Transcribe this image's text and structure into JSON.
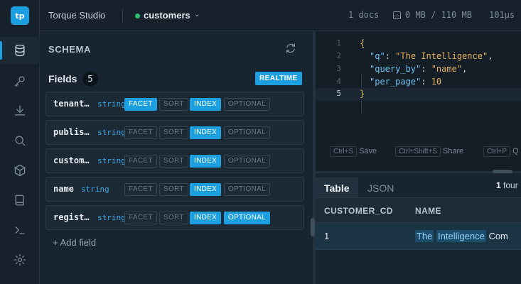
{
  "app": {
    "logo_text": "tp",
    "title": "Torque Studio"
  },
  "collection": {
    "name": "customers",
    "status_color": "#2fbf71"
  },
  "stats": {
    "docs": "1 docs",
    "disk": "0 MB / 110 MB",
    "latency": "101µs"
  },
  "rail": {
    "items": [
      {
        "icon": "database-icon",
        "active": true
      },
      {
        "icon": "key-icon"
      },
      {
        "icon": "download-icon"
      },
      {
        "icon": "search-icon"
      },
      {
        "icon": "cube-icon"
      },
      {
        "icon": "book-icon"
      },
      {
        "icon": "terminal-icon"
      },
      {
        "icon": "gear-icon"
      }
    ]
  },
  "schema": {
    "title": "SCHEMA",
    "fields_label": "Fields",
    "fields_count": "5",
    "realtime_label": "REALTIME",
    "add_field_label": "+ Add field",
    "tag_labels": {
      "facet": "FACET",
      "sort": "SORT",
      "index": "INDEX",
      "optional": "OPTIONAL"
    },
    "fields": [
      {
        "name": "tenant_id",
        "type": "string",
        "facet": true,
        "sort": false,
        "index": true,
        "optional": false
      },
      {
        "name": "published_at",
        "type": "string",
        "facet": false,
        "sort": false,
        "index": true,
        "optional": false
      },
      {
        "name": "customer_cd",
        "type": "string",
        "facet": false,
        "sort": false,
        "index": true,
        "optional": false
      },
      {
        "name": "name",
        "type": "string",
        "facet": false,
        "sort": false,
        "index": true,
        "optional": false
      },
      {
        "name": "registered_at",
        "type": "string",
        "facet": false,
        "sort": false,
        "index": true,
        "optional": true
      }
    ]
  },
  "editor": {
    "line_numbers": [
      "1",
      "2",
      "3",
      "4",
      "5"
    ],
    "query": {
      "q_key": "\"q\"",
      "q_val": "\"The Intelligence\"",
      "qb_key": "\"query_by\"",
      "qb_val": "\"name\"",
      "pp_key": "\"per_page\"",
      "pp_val": "10"
    },
    "shortcuts": [
      {
        "keys": "Ctrl+S",
        "label": "Save"
      },
      {
        "keys": "Ctrl+Shift+S",
        "label": "Share"
      },
      {
        "keys": "Ctrl+P",
        "label": "Q"
      }
    ]
  },
  "results": {
    "tabs": [
      "Table",
      "JSON"
    ],
    "found_count": "1",
    "found_label": "four",
    "columns": [
      "CUSTOMER_CD",
      "NAME"
    ],
    "rows": [
      {
        "customer_cd": "1",
        "name_parts": [
          "The",
          "Intelligence",
          "Com"
        ]
      }
    ]
  },
  "colors": {
    "accent": "#1b9fe0",
    "background": "#141e27",
    "panel": "#182530",
    "string_type": "#3aa8e6"
  }
}
